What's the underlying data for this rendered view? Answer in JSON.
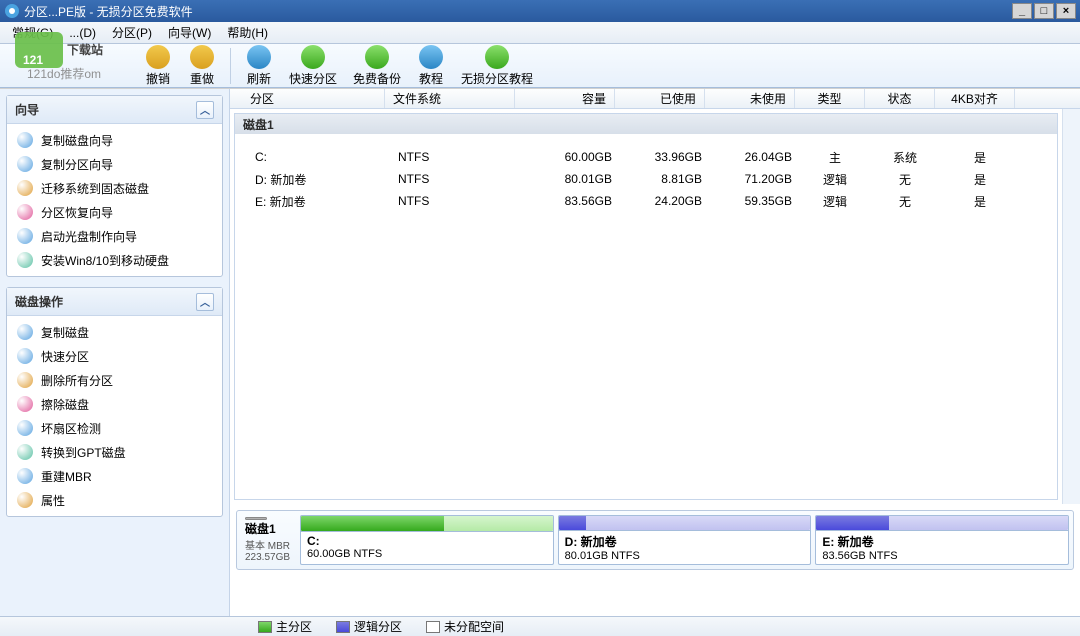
{
  "window": {
    "title": "分区...PE版 - 无损分区免费软件"
  },
  "menu": [
    "常规(G)",
    "...(D)",
    "分区(P)",
    "向导(W)",
    "帮助(H)"
  ],
  "toolbar": {
    "undo": "撤销",
    "redo": "重做",
    "refresh": "刷新",
    "quickpart": "快速分区",
    "freebackup": "免费备份",
    "tutorial": "教程",
    "losslesstut": "无损分区教程"
  },
  "watermark": {
    "brand": "121",
    "site": "121do推荐om",
    "name": "下载站"
  },
  "sidebar": {
    "wizard_title": "向导",
    "wizard": [
      "复制磁盘向导",
      "复制分区向导",
      "迁移系统到固态磁盘",
      "分区恢复向导",
      "启动光盘制作向导",
      "安装Win8/10到移动硬盘"
    ],
    "ops_title": "磁盘操作",
    "ops": [
      "复制磁盘",
      "快速分区",
      "删除所有分区",
      "擦除磁盘",
      "坏扇区检测",
      "转换到GPT磁盘",
      "重建MBR",
      "属性"
    ]
  },
  "grid": {
    "cols": {
      "part": "分区",
      "fs": "文件系统",
      "cap": "容量",
      "used": "已使用",
      "free": "未使用",
      "type": "类型",
      "stat": "状态",
      "align": "4KB对齐"
    },
    "disk_label": "磁盘1",
    "rows": [
      {
        "part": "C:",
        "fs": "NTFS",
        "cap": "60.00GB",
        "used": "33.96GB",
        "free": "26.04GB",
        "type": "主",
        "stat": "系统",
        "align": "是"
      },
      {
        "part": "D: 新加卷",
        "fs": "NTFS",
        "cap": "80.01GB",
        "used": "8.81GB",
        "free": "71.20GB",
        "type": "逻辑",
        "stat": "无",
        "align": "是"
      },
      {
        "part": "E: 新加卷",
        "fs": "NTFS",
        "cap": "83.56GB",
        "used": "24.20GB",
        "free": "59.35GB",
        "type": "逻辑",
        "stat": "无",
        "align": "是"
      }
    ]
  },
  "diskmap": {
    "disk": {
      "name": "磁盘1",
      "type": "基本 MBR",
      "size": "223.57GB"
    },
    "parts": [
      {
        "label": "C:",
        "sub": "60.00GB NTFS",
        "color": "green",
        "usedPct": 57
      },
      {
        "label": "D: 新加卷",
        "sub": "80.01GB NTFS",
        "color": "blue",
        "usedPct": 11
      },
      {
        "label": "E: 新加卷",
        "sub": "83.56GB NTFS",
        "color": "blue",
        "usedPct": 29
      }
    ]
  },
  "legend": {
    "primary": "主分区",
    "logical": "逻辑分区",
    "unalloc": "未分配空间"
  }
}
